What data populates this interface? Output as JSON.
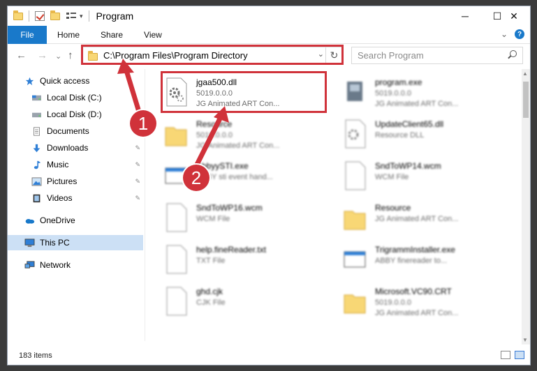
{
  "window": {
    "title": "Program",
    "minimize": "─",
    "maximize": "☐",
    "close": "✕"
  },
  "ribbon": {
    "file": "File",
    "tabs": [
      "Home",
      "Share",
      "View"
    ],
    "expand": "⌄",
    "help": "?"
  },
  "nav": {
    "back": "←",
    "forward": "→",
    "recent": "⌄",
    "up": "↑",
    "address": "C:\\Program Files\\Program Directory",
    "address_dropdown": "⌄",
    "refresh": "↻",
    "search_placeholder": "Search Program"
  },
  "sidebar": {
    "items": [
      {
        "label": "Quick access",
        "icon": "star-icon"
      },
      {
        "label": "Local Disk (C:)",
        "icon": "drive-icon"
      },
      {
        "label": "Local Disk (D:)",
        "icon": "drive-icon"
      },
      {
        "label": "Documents",
        "icon": "documents-icon"
      },
      {
        "label": "Downloads",
        "icon": "downloads-icon",
        "pinned": true
      },
      {
        "label": "Music",
        "icon": "music-icon",
        "pinned": true
      },
      {
        "label": "Pictures",
        "icon": "pictures-icon",
        "pinned": true
      },
      {
        "label": "Videos",
        "icon": "videos-icon",
        "pinned": true
      },
      {
        "label": "OneDrive",
        "icon": "cloud-icon"
      },
      {
        "label": "This PC",
        "icon": "computer-icon",
        "selected": true
      },
      {
        "label": "Network",
        "icon": "network-icon"
      }
    ],
    "pin_glyph": "📌"
  },
  "files": [
    {
      "name": "jgaa500.dll",
      "line2": "5019.0.0.0",
      "line3": "JG Animated ART Con...",
      "icon": "dll-gear-icon"
    },
    {
      "name": "program.exe",
      "line2": "5019.0.0.0",
      "line3": "JG Animated ART Con...",
      "icon": "exe-icon"
    },
    {
      "name": "Resource",
      "line2": "5019.0.0.0",
      "line3": "JG Animated ART Con...",
      "icon": "folder-icon"
    },
    {
      "name": "UpdateClient65.dll",
      "line2": "Resource DLL",
      "line3": "",
      "icon": "dll-gear-icon"
    },
    {
      "name": "AbbyySTI.exe",
      "line2": "ABBY sti event hand...",
      "line3": "",
      "icon": "app-window-icon"
    },
    {
      "name": "SndToWP14.wcm",
      "line2": "WCM File",
      "line3": "",
      "icon": "blank-file-icon"
    },
    {
      "name": "SndToWP16.wcm",
      "line2": "WCM File",
      "line3": "",
      "icon": "blank-file-icon"
    },
    {
      "name": "Resource",
      "line2": "JG Animated ART Con...",
      "line3": "",
      "icon": "folder-icon"
    },
    {
      "name": "help.fineReader.txt",
      "line2": "TXT File",
      "line3": "",
      "icon": "blank-file-icon"
    },
    {
      "name": "TrigrammInstaller.exe",
      "line2": "ABBY finereader to...",
      "line3": "",
      "icon": "app-window-icon"
    },
    {
      "name": "ghd.cjk",
      "line2": "CJK File",
      "line3": "",
      "icon": "blank-file-icon"
    },
    {
      "name": "Microsoft.VC90.CRT",
      "line2": "5019.0.0.0",
      "line3": "JG Animated ART Con...",
      "icon": "folder-icon"
    }
  ],
  "status": {
    "item_count": "183 items"
  },
  "annotations": {
    "step1": "1",
    "step2": "2",
    "accent_color": "#d0323a"
  },
  "colors": {
    "file_tab": "#1979ca",
    "selection": "#cce0f5",
    "folder": "#f8d775"
  }
}
